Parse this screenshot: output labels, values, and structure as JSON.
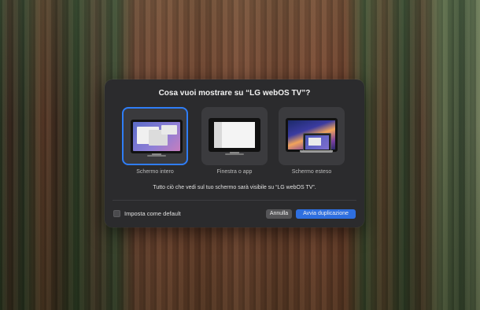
{
  "dialog": {
    "title": "Cosa vuoi mostrare su “LG webOS TV”?",
    "options": [
      {
        "label": "Schermo intero",
        "selected": true,
        "icon": "full-screen-mirror-icon"
      },
      {
        "label": "Finestra o app",
        "selected": false,
        "icon": "window-or-app-icon"
      },
      {
        "label": "Schermo esteso",
        "selected": false,
        "icon": "extended-display-icon"
      }
    ],
    "notice": "Tutto ciò che vedi sul tuo schermo sarà visibile su “LG webOS TV”.",
    "checkbox": {
      "label": "Imposta come default",
      "checked": false
    },
    "buttons": {
      "cancel": "Annulla",
      "primary": "Avvia duplicazione"
    }
  },
  "colors": {
    "accent": "#2f7df6",
    "primary_button": "#2e6fe0",
    "dialog_bg": "#2b2b2d"
  }
}
